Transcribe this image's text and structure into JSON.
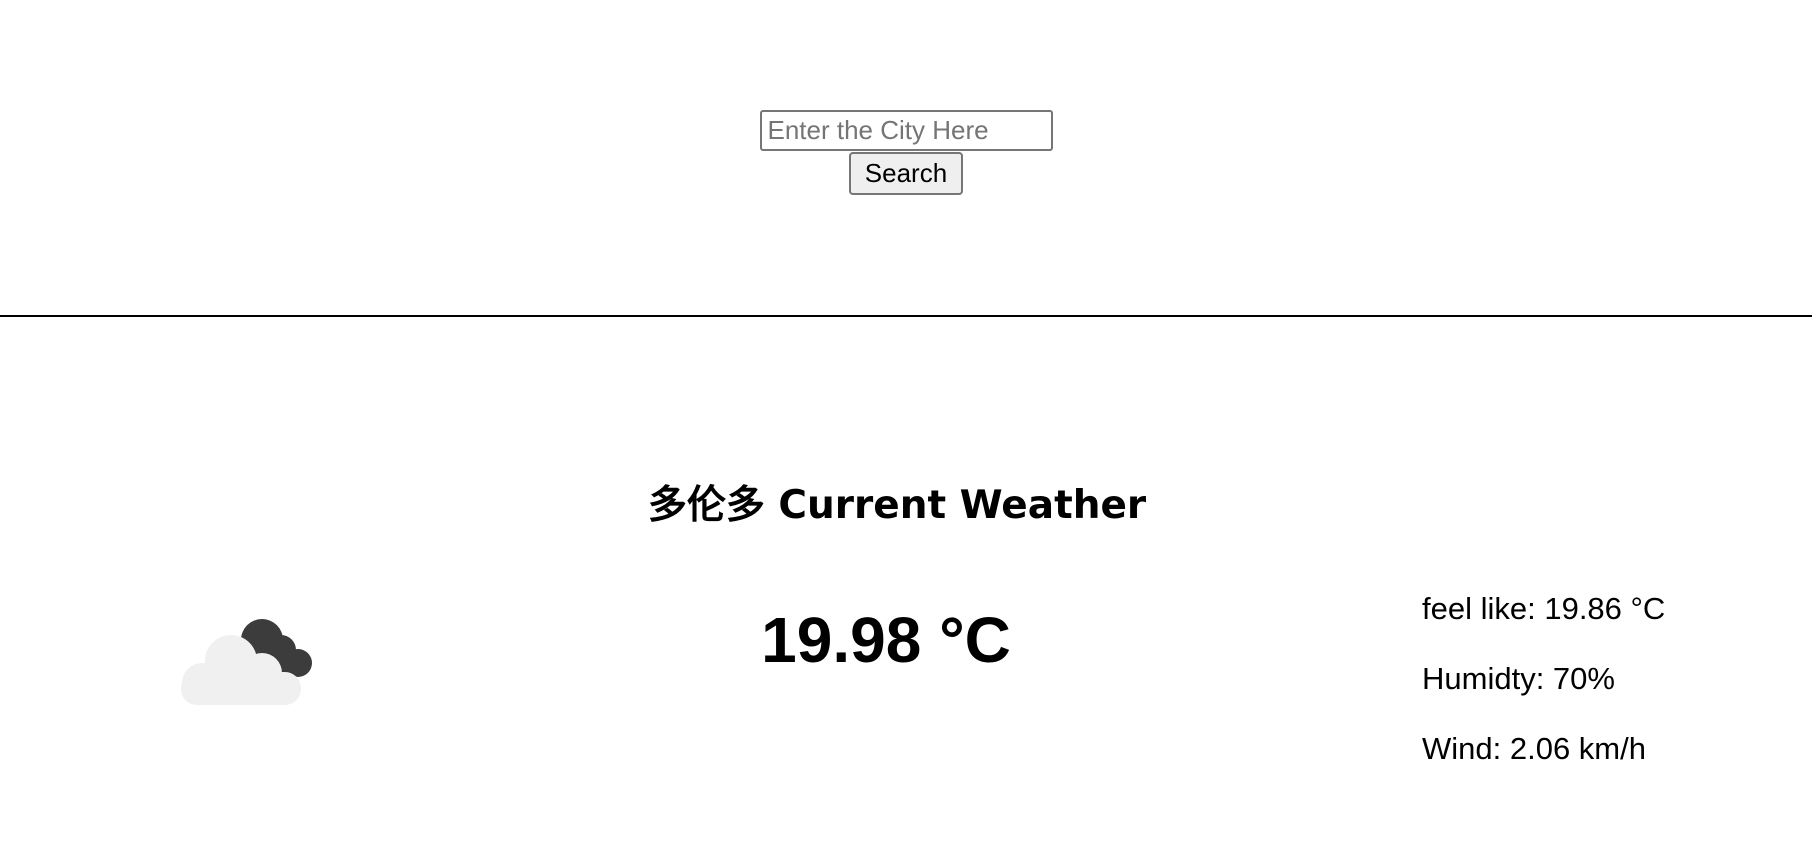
{
  "search": {
    "placeholder": "Enter the City Here",
    "value": "",
    "button_label": "Search"
  },
  "weather": {
    "title": "多伦多 Current Weather",
    "temperature": "19.98 °C",
    "icon": "partly-cloudy-icon",
    "details": {
      "feels_like": "feel like: 19.86 °C",
      "humidity": "Humidty: 70%",
      "wind": "Wind: 2.06 km/h"
    }
  },
  "colors": {
    "cloud_light": "#f0f0f0",
    "cloud_dark": "#3c3c3c",
    "divider": "#000000"
  }
}
